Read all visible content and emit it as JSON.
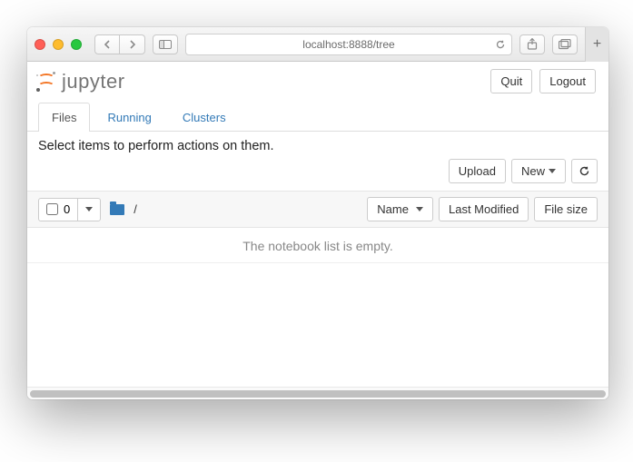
{
  "browser": {
    "address": "localhost:8888/tree"
  },
  "logo": {
    "text": "jupyter"
  },
  "header": {
    "quit": "Quit",
    "logout": "Logout"
  },
  "tabs": {
    "files": "Files",
    "running": "Running",
    "clusters": "Clusters"
  },
  "hint": "Select items to perform actions on them.",
  "actions": {
    "upload": "Upload",
    "new": "New"
  },
  "list": {
    "selected_count": "0",
    "breadcrumb_root": "/",
    "col_name": "Name",
    "col_modified": "Last Modified",
    "col_size": "File size",
    "empty_message": "The notebook list is empty."
  }
}
